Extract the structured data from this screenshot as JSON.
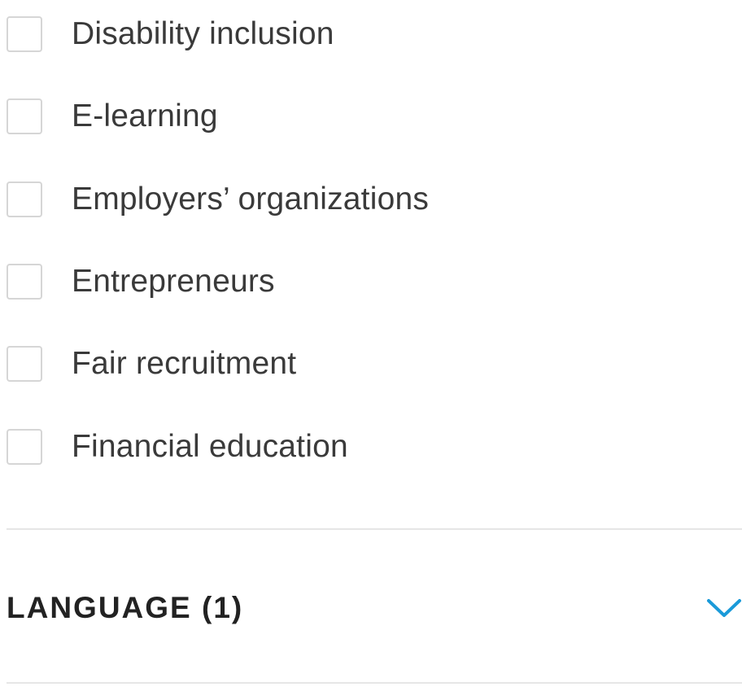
{
  "filters": {
    "items": [
      {
        "label": "Disability inclusion",
        "checked": false
      },
      {
        "label": "E-learning",
        "checked": false
      },
      {
        "label": "Employers’ organizations",
        "checked": false
      },
      {
        "label": "Entrepreneurs",
        "checked": false
      },
      {
        "label": "Fair recruitment",
        "checked": false
      },
      {
        "label": "Financial education",
        "checked": false
      }
    ]
  },
  "language_section": {
    "title": "LANGUAGE (1)",
    "toggle_icon": "chevron-down-icon",
    "accent_color": "#1a9ad9"
  }
}
